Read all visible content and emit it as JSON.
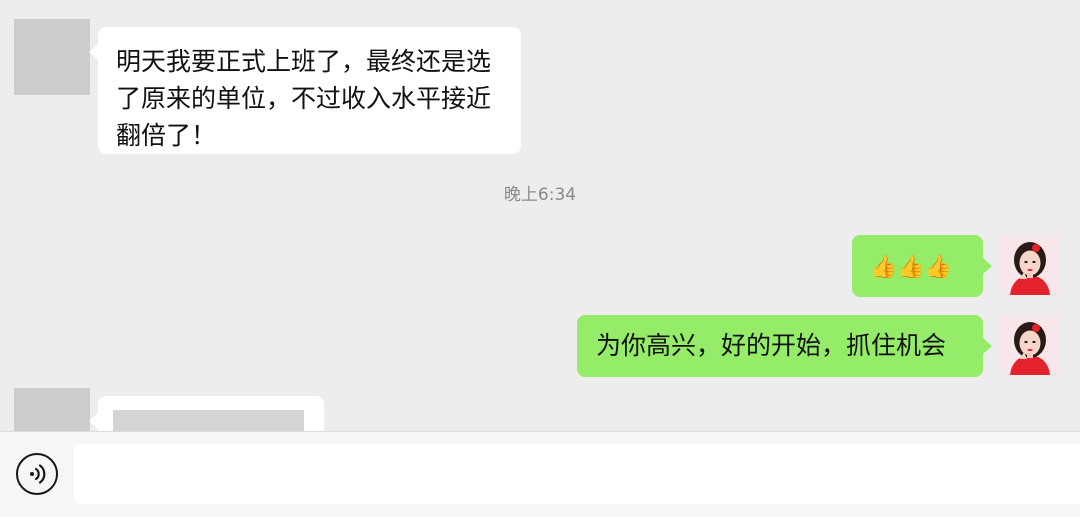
{
  "conversation": {
    "messages": [
      {
        "direction": "incoming",
        "text": "明天我要正式上班了，最终还是选了原来的单位，不过收入水平接近翻倍了！",
        "lines": [
          "明天我要正式上班了，最终还是选",
          "了原来的单位，不过收入水平接近",
          "翻倍了！"
        ]
      },
      {
        "direction": "timestamp",
        "text": "晚上6:34"
      },
      {
        "direction": "outgoing",
        "text": "👍👍👍",
        "emoji": [
          "👍",
          "👍",
          "👍"
        ]
      },
      {
        "direction": "outgoing",
        "text": "为你高兴，好的开始，抓住机会"
      },
      {
        "direction": "incoming",
        "text": ""
      }
    ]
  },
  "input": {
    "value": "",
    "placeholder": ""
  },
  "icons": {
    "voice": "voice-input-icon",
    "self_avatar": "profile-photo",
    "contact_avatar": "redacted-avatar"
  },
  "colors": {
    "background": "#ededed",
    "outgoing_bubble": "#95ec69",
    "incoming_bubble": "#ffffff",
    "timestamp_text": "#8a8a8a"
  }
}
